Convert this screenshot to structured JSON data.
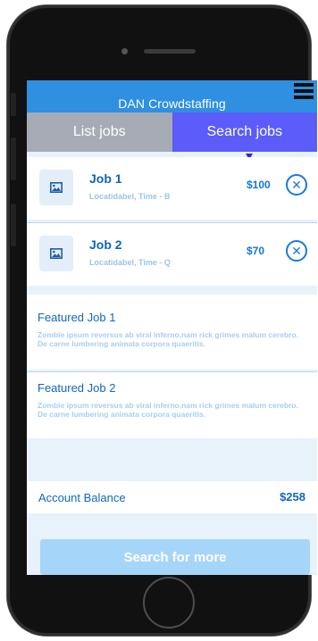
{
  "app": {
    "title": "DAN Crowdstaffing"
  },
  "tabs": [
    {
      "label": "List jobs",
      "active": false
    },
    {
      "label": "Search jobs",
      "active": true
    }
  ],
  "jobs": [
    {
      "title": "Job 1",
      "subtitle": "Locatidabel, Time - B",
      "price": "$100"
    },
    {
      "title": "Job 2",
      "subtitle": "Locatidabel, Time - Q",
      "price": "$70"
    }
  ],
  "featured": [
    {
      "title": "Featured Job 1",
      "description": "Zombie ipsum reversus ab viral inferno,nam rick grimes malum cerebro. De carne lumbering animata corpora quaeritis."
    },
    {
      "title": "Featured Job 2",
      "description": "Zombie ipsum reversus ab viral inferno,nam rick grimes malum cerebro. De carne lumbering animata corpora quaeritis."
    }
  ],
  "account": {
    "label": "Account Balance",
    "value": "$258"
  },
  "actions": {
    "search_more": "Search for more"
  },
  "icons": {
    "menu": "hamburger-menu-icon",
    "thumbnail": "image-icon",
    "remove": "close-circle-icon",
    "tab_indicator": "caret-down-icon"
  },
  "colors": {
    "header": "#2f8fe0",
    "tab_active": "#5b5cf9",
    "tab_inactive": "#a5acb5",
    "accent_text": "#1266bf",
    "button": "#a6d5fa"
  }
}
